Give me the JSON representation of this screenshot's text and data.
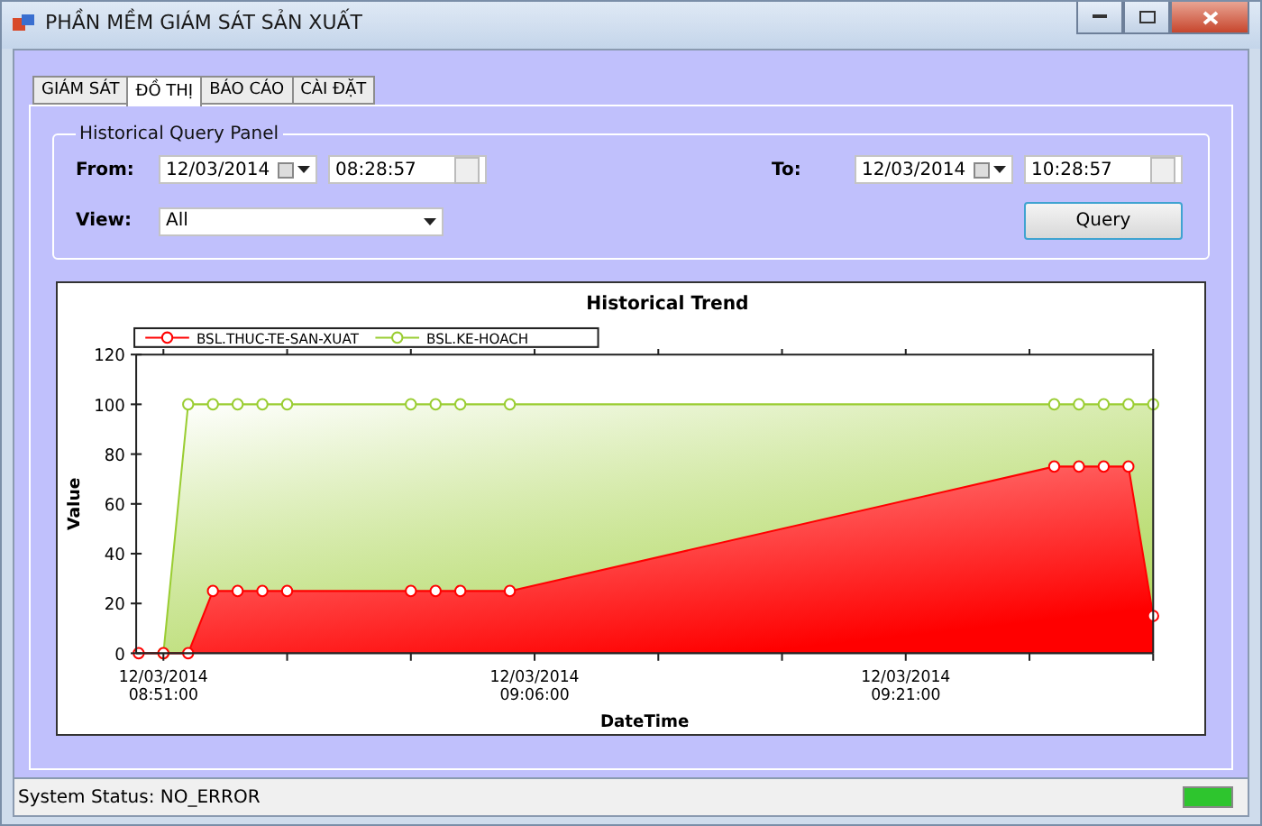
{
  "window": {
    "title": "PHẦN MỀM GIÁM SÁT SẢN XUẤT"
  },
  "tabs": [
    {
      "label": "GIÁM SÁT",
      "selected": false
    },
    {
      "label": "ĐỒ THỊ",
      "selected": true
    },
    {
      "label": "BÁO CÁO",
      "selected": false
    },
    {
      "label": "CÀI ĐẶT",
      "selected": false
    }
  ],
  "query_panel": {
    "title": "Historical Query Panel",
    "from": {
      "label": "From:",
      "date": "12/03/2014",
      "time": "08:28:57"
    },
    "to": {
      "label": "To:",
      "date": "12/03/2014",
      "time": "10:28:57"
    },
    "view": {
      "label": "View:",
      "value": "All"
    },
    "query_button": "Query"
  },
  "chart": {
    "chart_data": {
      "type": "area",
      "title": "Historical Trend",
      "xlabel": "DateTime",
      "ylabel": "Value",
      "categories": [
        null,
        "12/03/2014 08:51:00",
        null,
        null,
        null,
        null,
        null,
        null,
        null,
        null,
        null,
        null,
        null,
        null,
        null,
        null,
        "12/03/2014 09:06:00",
        null,
        null,
        null,
        null,
        null,
        null,
        null,
        null,
        null,
        null,
        null,
        null,
        null,
        null,
        "12/03/2014 09:21:00",
        null,
        null,
        null,
        null,
        null,
        null,
        null,
        null,
        null,
        null
      ],
      "series": [
        {
          "name": "BSL.THUC-TE-SAN-XUAT",
          "color": "#ff0000",
          "values": [
            0,
            0,
            0,
            25,
            25,
            25,
            25,
            null,
            null,
            null,
            null,
            25,
            25,
            25,
            null,
            25,
            null,
            null,
            null,
            null,
            null,
            null,
            null,
            null,
            null,
            null,
            null,
            null,
            null,
            null,
            null,
            null,
            null,
            null,
            null,
            null,
            null,
            75,
            75,
            75,
            75,
            15
          ]
        },
        {
          "name": "BSL.KE-HOACH",
          "color": "#9acd32",
          "values": [
            null,
            0,
            100,
            100,
            100,
            100,
            100,
            null,
            null,
            null,
            null,
            100,
            100,
            100,
            null,
            100,
            null,
            null,
            null,
            null,
            null,
            null,
            null,
            null,
            null,
            null,
            null,
            null,
            null,
            null,
            null,
            null,
            null,
            null,
            null,
            null,
            null,
            100,
            100,
            100,
            100,
            100
          ]
        }
      ],
      "legend": "top",
      "ylim": [
        0,
        120
      ],
      "yticks": [
        0,
        20,
        40,
        60,
        80,
        100,
        120
      ]
    }
  },
  "status_bar": {
    "text": "System Status: NO_ERROR",
    "level": 1
  }
}
